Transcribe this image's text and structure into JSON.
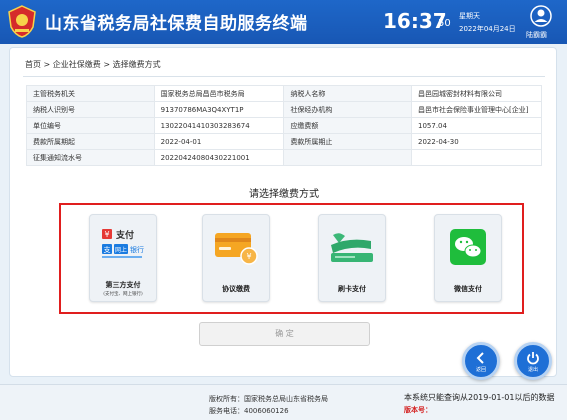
{
  "header": {
    "title": "山东省税务局社保费自助服务终端",
    "time": "16:37",
    "seconds": "50",
    "weekday": "星期天",
    "date": "2022年04月24日",
    "user_label": "陆霸霸"
  },
  "breadcrumb": "首页 > 企业社保缴费 > 选择缴费方式",
  "info_rows": [
    [
      "主管税务机关",
      "国家税务总局昌邑市税务局",
      "纳税人名称",
      "昌邑园城密封材料有限公司"
    ],
    [
      "纳税人识别号",
      "91370786MA3Q4XYT1P",
      "社保经办机构",
      "昌邑市社会保险事业管理中心[企业]"
    ],
    [
      "单位编号",
      "13022041410303283674",
      "应缴费额",
      "1057.04"
    ],
    [
      "费款所属期起",
      "2022-04-01",
      "费款所属期止",
      "2022-04-30"
    ],
    [
      "征集通知流水号",
      "20220424080430221001",
      "",
      ""
    ]
  ],
  "choose_title": "请选择缴费方式",
  "options": [
    {
      "label": "第三方支付",
      "sub": "(支付宝、网上银行)",
      "icon": "third-party-pay-icon"
    },
    {
      "label": "协议缴费",
      "icon": "agreement-card-icon"
    },
    {
      "label": "刷卡支付",
      "icon": "card-swipe-icon"
    },
    {
      "label": "微信支付",
      "icon": "wechat-icon"
    }
  ],
  "icon_text": {
    "pay": "支付",
    "pay_en": "支",
    "netbank": "网上",
    "netbank2": "银行",
    "yen": "¥"
  },
  "confirm_label": "确 定",
  "back_label": "返回",
  "exit_label": "退出",
  "footer": {
    "copyright": "版权所有：国家税务总局山东省税务局",
    "hotline": "服务电话：4006060126",
    "notice": "本系统只能查询从2019-01-01以后的数据",
    "version": "版本号："
  },
  "colors": {
    "header": "#1e67c9",
    "highlight_border": "#e01e1e",
    "round_button": "#1e6fd6"
  }
}
